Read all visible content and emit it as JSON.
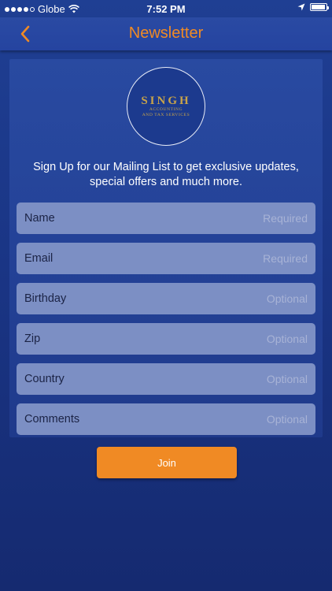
{
  "status_bar": {
    "carrier": "Globe",
    "time": "7:52 PM",
    "signal_bars_filled": 4,
    "signal_bars_total": 5,
    "battery_level": 0.95
  },
  "nav": {
    "back_icon": "chevron-left-icon",
    "title": "Newsletter"
  },
  "logo": {
    "main": "SINGH",
    "sub_line1": "ACCOUNTING",
    "sub_line2": "AND TAX SERVICES"
  },
  "intro_text": "Sign Up for our Mailing List to get exclusive updates, special offers and much more.",
  "fields": [
    {
      "label": "Name",
      "placeholder": "Required",
      "value": ""
    },
    {
      "label": "Email",
      "placeholder": "Required",
      "value": ""
    },
    {
      "label": "Birthday",
      "placeholder": "Optional",
      "value": ""
    },
    {
      "label": "Zip",
      "placeholder": "Optional",
      "value": ""
    },
    {
      "label": "Country",
      "placeholder": "Optional",
      "value": ""
    },
    {
      "label": "Comments",
      "placeholder": "Optional",
      "value": ""
    }
  ],
  "join_label": "Join",
  "colors": {
    "accent": "#f08a24",
    "background": "#1f3f93",
    "field": "#7c8fc4",
    "logo_gold": "#c9a449"
  }
}
